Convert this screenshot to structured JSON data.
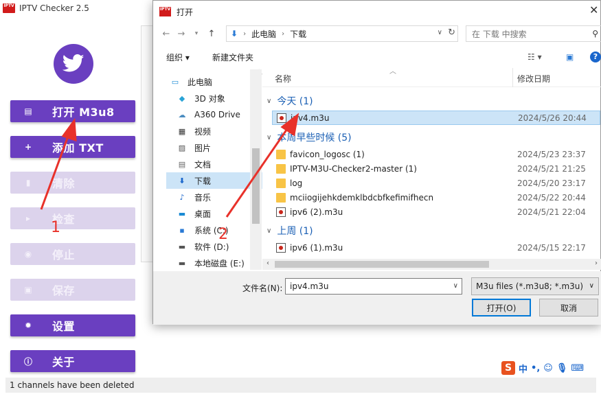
{
  "app": {
    "logo_text": "IPTV\nChecker",
    "title": "IPTV Checker 2.5",
    "buttons": [
      {
        "label": "打开 M3u8",
        "state": "active"
      },
      {
        "label": "添加 TXT",
        "state": "active"
      },
      {
        "label": "清除",
        "state": "disabled"
      },
      {
        "label": "检查",
        "state": "disabled"
      },
      {
        "label": "停止",
        "state": "disabled"
      },
      {
        "label": "保存",
        "state": "disabled"
      },
      {
        "label": "设置",
        "state": "active"
      },
      {
        "label": "关于",
        "state": "active"
      }
    ],
    "status": "1 channels have been deleted",
    "accent": "#6a3fc0",
    "ime": {
      "logo": "S",
      "lang": "中",
      "punct": "•,"
    }
  },
  "dialog": {
    "title": "打开",
    "breadcrumb": [
      "此电脑",
      "下载"
    ],
    "search_placeholder": "在 下载 中搜索",
    "toolbar": {
      "organize": "组织 ▾",
      "new_folder": "新建文件夹"
    },
    "nav_items": [
      {
        "label": "此电脑",
        "icon": "computer-icon"
      },
      {
        "label": "3D 对象",
        "icon": "3d-objects-icon"
      },
      {
        "label": "A360 Drive",
        "icon": "cloud-drive-icon"
      },
      {
        "label": "视频",
        "icon": "video-icon"
      },
      {
        "label": "图片",
        "icon": "picture-icon"
      },
      {
        "label": "文档",
        "icon": "document-icon"
      },
      {
        "label": "下载",
        "icon": "download-icon"
      },
      {
        "label": "音乐",
        "icon": "music-icon"
      },
      {
        "label": "桌面",
        "icon": "desktop-icon"
      },
      {
        "label": "系统 (C:)",
        "icon": "drive-icon"
      },
      {
        "label": "软件 (D:)",
        "icon": "drive-icon"
      },
      {
        "label": "本地磁盘 (E:)",
        "icon": "drive-icon"
      }
    ],
    "columns": {
      "name": "名称",
      "modified": "修改日期"
    },
    "groups": [
      {
        "title": "今天 (1)",
        "files": [
          {
            "name": "ipv4.m3u",
            "date": "2024/5/26 20:44",
            "type": "m3u",
            "selected": true
          }
        ]
      },
      {
        "title": "本周早些时候 (5)",
        "files": [
          {
            "name": "favicon_logosc (1)",
            "date": "2024/5/23 23:37",
            "type": "folder"
          },
          {
            "name": "IPTV-M3U-Checker2-master (1)",
            "date": "2024/5/21 21:25",
            "type": "folder"
          },
          {
            "name": "log",
            "date": "2024/5/20 23:17",
            "type": "folder"
          },
          {
            "name": "mciiogijehkdemklbdcbfkefimifhecn",
            "date": "2024/5/22 20:44",
            "type": "folder"
          },
          {
            "name": "ipv6 (2).m3u",
            "date": "2024/5/21 22:04",
            "type": "m3u"
          }
        ]
      },
      {
        "title": "上周 (1)",
        "files": [
          {
            "name": "ipv6 (1).m3u",
            "date": "2024/5/15 22:17",
            "type": "m3u"
          }
        ]
      }
    ],
    "filename_label": "文件名(N):",
    "filename_value": "ipv4.m3u",
    "filter": "M3u files (*.m3u8; *.m3u)",
    "open_button": "打开(O)",
    "cancel_button": "取消"
  },
  "annotations": {
    "step1": "1",
    "step2": "2",
    "color": "#e8312a"
  }
}
